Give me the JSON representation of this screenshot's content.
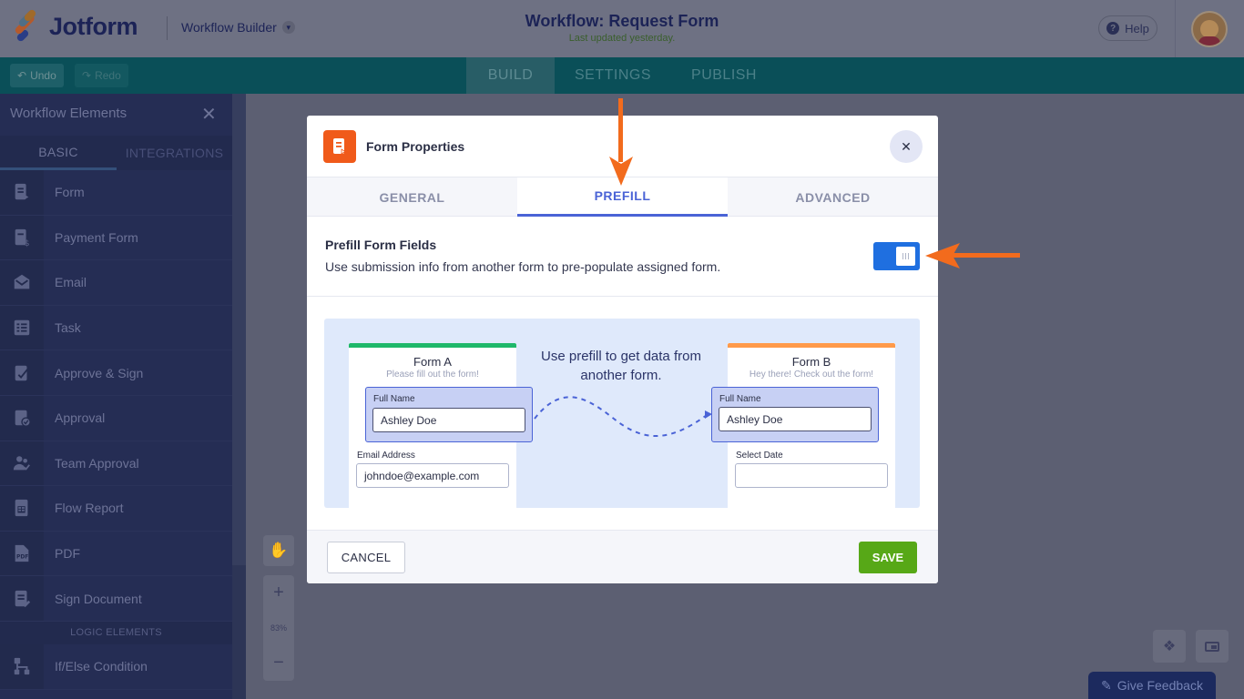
{
  "header": {
    "logo_text": "Jotform",
    "product": "Workflow Builder",
    "title": "Workflow: Request Form",
    "subtitle": "Last updated yesterday.",
    "help_label": "Help"
  },
  "toolbar": {
    "undo_label": "Undo",
    "redo_label": "Redo",
    "tabs": [
      "BUILD",
      "SETTINGS",
      "PUBLISH"
    ],
    "active_tab": "BUILD"
  },
  "sidebar": {
    "title": "Workflow Elements",
    "tabs": [
      "BASIC",
      "INTEGRATIONS"
    ],
    "items": [
      {
        "label": "Form",
        "icon": "form-icon"
      },
      {
        "label": "Payment Form",
        "icon": "payment-form-icon"
      },
      {
        "label": "Email",
        "icon": "email-icon"
      },
      {
        "label": "Task",
        "icon": "task-icon"
      },
      {
        "label": "Approve & Sign",
        "icon": "approve-sign-icon"
      },
      {
        "label": "Approval",
        "icon": "approval-icon"
      },
      {
        "label": "Team Approval",
        "icon": "team-approval-icon"
      },
      {
        "label": "Flow Report",
        "icon": "flow-report-icon"
      },
      {
        "label": "PDF",
        "icon": "pdf-icon"
      },
      {
        "label": "Sign Document",
        "icon": "sign-document-icon"
      }
    ],
    "logic_section": "LOGIC ELEMENTS",
    "logic_items": [
      {
        "label": "If/Else Condition",
        "icon": "condition-icon"
      }
    ]
  },
  "canvas": {
    "zoom": "83%",
    "feedback_label": "Give Feedback"
  },
  "modal": {
    "title": "Form Properties",
    "tabs": [
      "GENERAL",
      "PREFILL",
      "ADVANCED"
    ],
    "active_tab": "PREFILL",
    "prefill_title": "Prefill Form Fields",
    "prefill_desc": "Use submission info from another form to pre-populate assigned form.",
    "prefill_enabled": true,
    "illustration": {
      "center_text": "Use prefill to get data from another form.",
      "form_a": {
        "title": "Form A",
        "subtitle": "Please fill out the form!",
        "field1_label": "Full Name",
        "field1_value": "Ashley Doe",
        "field2_label": "Email Address",
        "field2_value": "johndoe@example.com"
      },
      "form_b": {
        "title": "Form B",
        "subtitle": "Hey there! Check out the form!",
        "field1_label": "Full Name",
        "field1_value": "Ashley Doe",
        "field2_label": "Select Date",
        "field2_value": ""
      }
    },
    "cancel_label": "CANCEL",
    "save_label": "SAVE"
  },
  "colors": {
    "accent": "#4a63d6",
    "brand_orange": "#f05a1a",
    "save_green": "#57a817",
    "toggle_blue": "#1f6fe0",
    "annotation_arrow": "#f26b1d"
  }
}
